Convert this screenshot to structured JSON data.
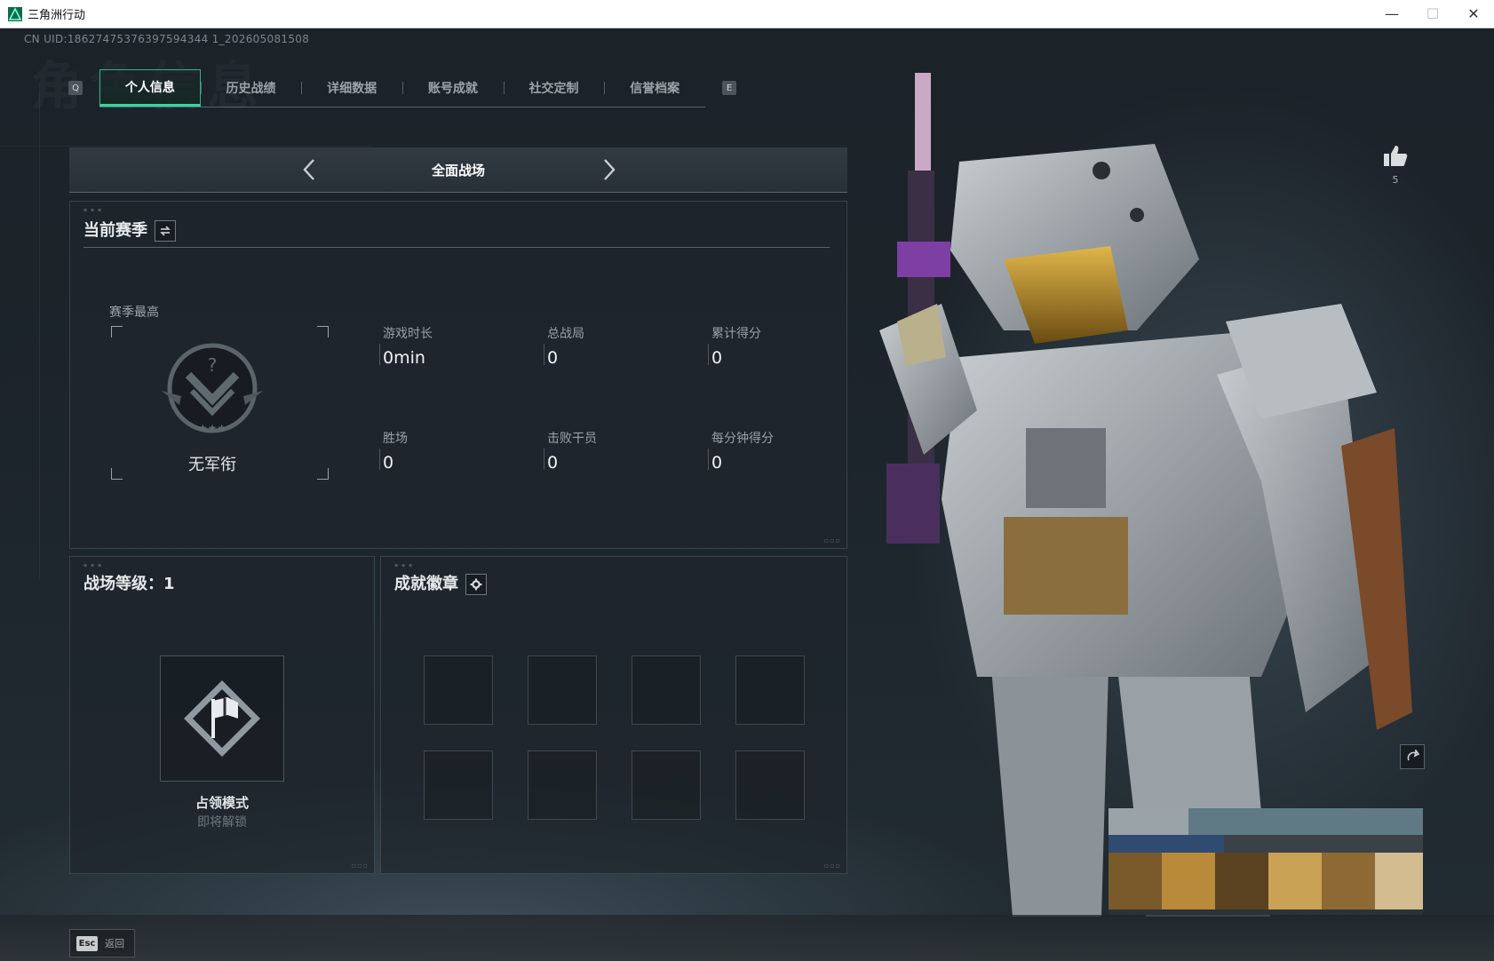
{
  "window": {
    "title": "三角洲行动",
    "minimize_glyph": "—",
    "maximize_glyph": "☐",
    "close_glyph": "✕"
  },
  "background_watermark": "角色信息",
  "uid_text": "CN UID:18627475376397594344 1_202605081508",
  "tabs": {
    "left_key": "Q",
    "right_key": "E",
    "items": [
      {
        "label": "个人信息",
        "active": true
      },
      {
        "label": "历史战绩",
        "active": false
      },
      {
        "label": "详细数据",
        "active": false
      },
      {
        "label": "账号成就",
        "active": false
      },
      {
        "label": "社交定制",
        "active": false
      },
      {
        "label": "信誉档案",
        "active": false
      }
    ]
  },
  "mode_selector": {
    "title": "全面战场",
    "prev_icon": "chevron-left-icon",
    "next_icon": "chevron-right-icon"
  },
  "season_panel": {
    "title": "当前赛季",
    "switch_icon": "swap-icon",
    "best_label": "赛季最高",
    "rank_name": "无军衔",
    "stats": [
      {
        "label": "游戏时长",
        "value": "0min"
      },
      {
        "label": "总战局",
        "value": "0"
      },
      {
        "label": "累计得分",
        "value": "0"
      },
      {
        "label": "胜场",
        "value": "0"
      },
      {
        "label": "击败干员",
        "value": "0"
      },
      {
        "label": "每分钟得分",
        "value": "0"
      }
    ]
  },
  "level_panel": {
    "title": "战场等级：1",
    "mode_name": "占领模式",
    "mode_status": "即将解锁"
  },
  "badge_panel": {
    "title": "成就徽章",
    "settings_icon": "gear-icon",
    "slot_count": 8
  },
  "like": {
    "icon": "thumbs-up-icon",
    "count": "5"
  },
  "bottom": {
    "esc_key": "Esc",
    "back_label": "返回"
  },
  "colors": {
    "accent": "#38d59f",
    "panel_bg": "#1e262c",
    "text_primary": "#f0f3f4",
    "text_secondary": "#98a2a7"
  }
}
